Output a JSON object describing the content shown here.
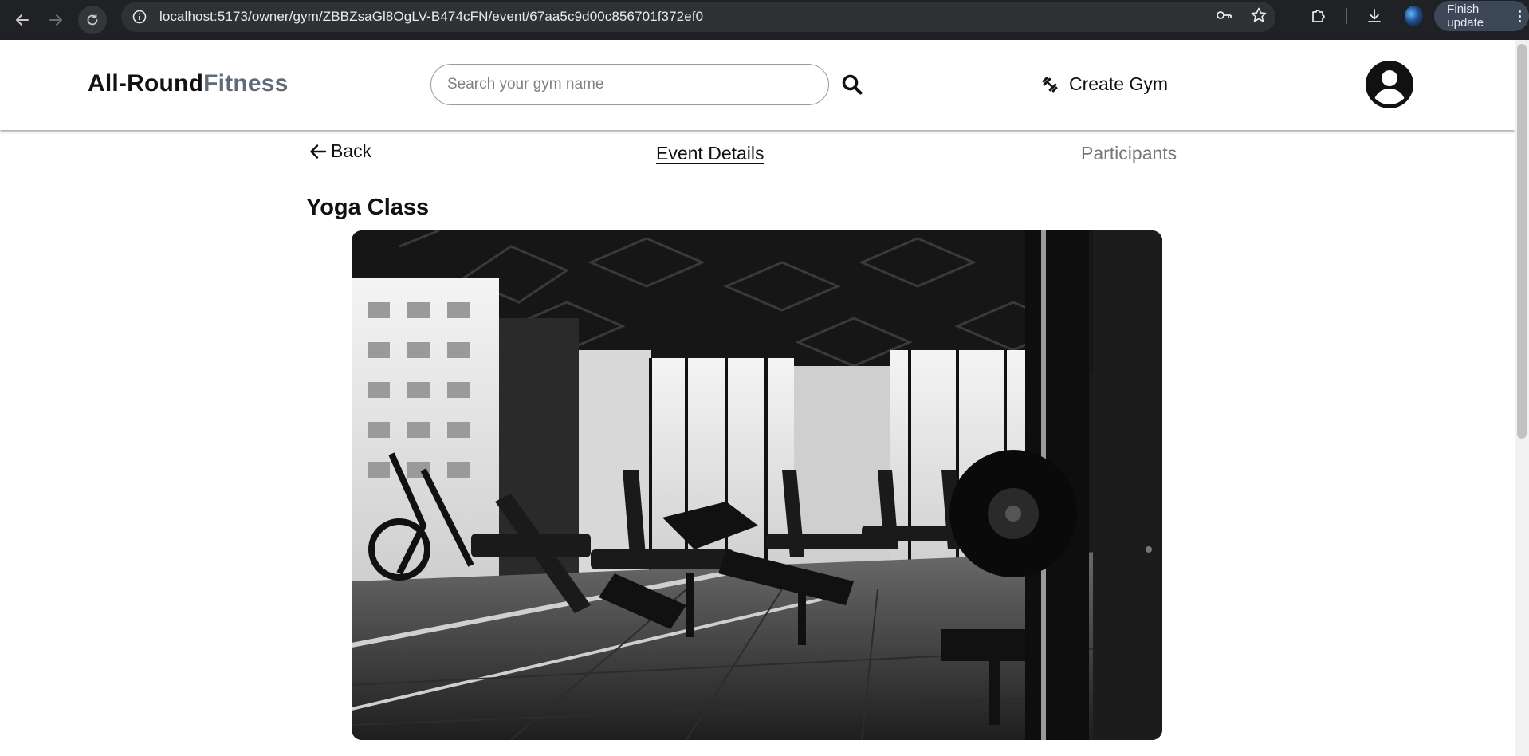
{
  "browser": {
    "url": "localhost:5173/owner/gym/ZBBZsaGl8OgLV-B474cFN/event/67aa5c9d00c856701f372ef0",
    "finish_update_label": "Finish update"
  },
  "header": {
    "logo_part1": "All-Round",
    "logo_part2": "Fitness",
    "search_placeholder": "Search your gym name",
    "create_gym_label": "Create Gym"
  },
  "subnav": {
    "back_label": "Back",
    "tab_event_details": "Event Details",
    "tab_participants": "Participants",
    "active_tab": "Event Details"
  },
  "event": {
    "title": "Yoga Class",
    "image_subject": "gym interior with treadmills and weight benches (black and white photo)"
  },
  "colors": {
    "chrome_bg": "#202124",
    "logo_accent": "#5f6b78",
    "inactive_tab": "#777777"
  }
}
